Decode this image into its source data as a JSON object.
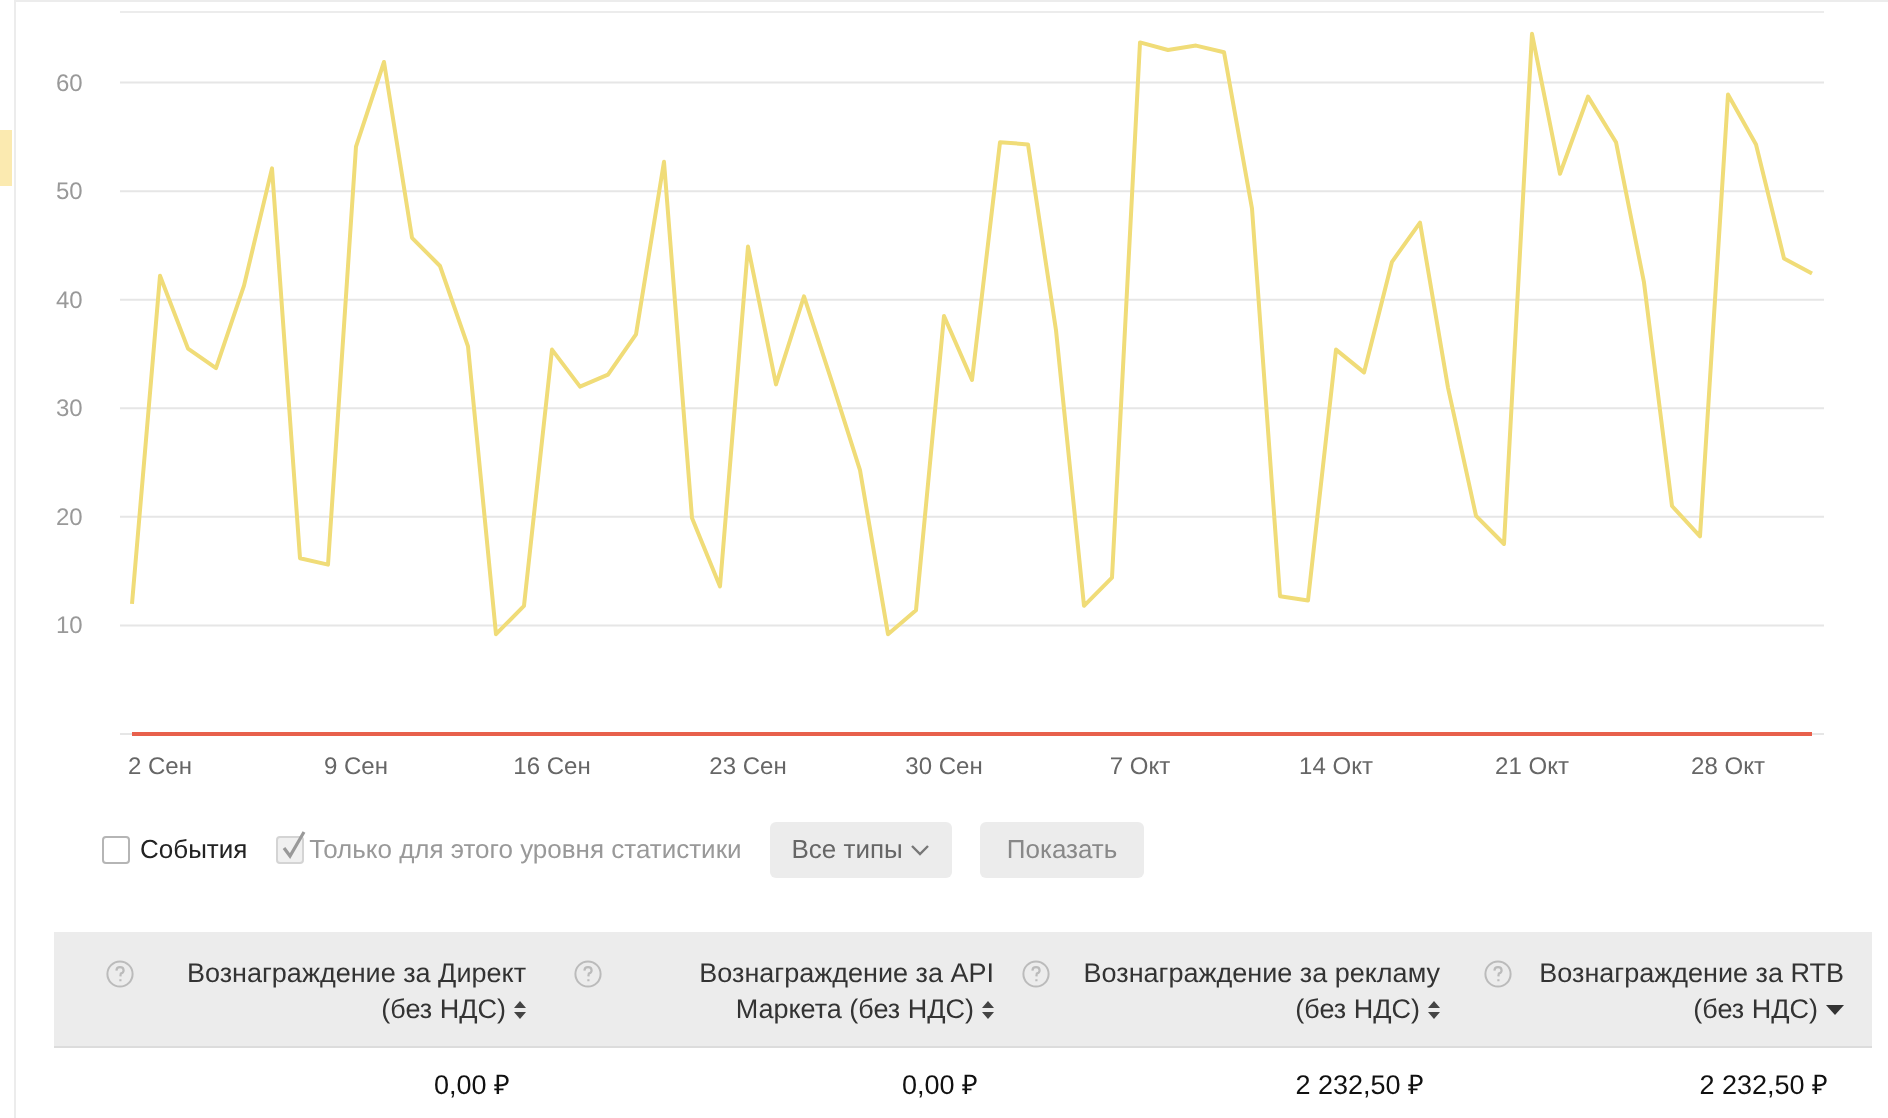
{
  "chart": {
    "chart_data": {
      "type": "line",
      "grid": true,
      "ylim": [
        0,
        66.5
      ],
      "categories": [
        null,
        "2 Сен",
        null,
        null,
        null,
        null,
        null,
        null,
        "9 Сен",
        null,
        null,
        null,
        null,
        null,
        null,
        "16 Сен",
        null,
        null,
        null,
        null,
        null,
        null,
        "23 Сен",
        null,
        null,
        null,
        null,
        null,
        null,
        "30 Сен",
        null,
        null,
        null,
        null,
        null,
        null,
        "7 Окт",
        null,
        null,
        null,
        null,
        null,
        null,
        "14 Окт",
        null,
        null,
        null,
        null,
        null,
        null,
        "21 Окт",
        null,
        null,
        null,
        null,
        null,
        null,
        "28 Окт",
        null,
        null,
        null
      ],
      "series": [
        {
          "color": "#f0dc78",
          "values": [
            12,
            42.2,
            35.5,
            33.7,
            41.3,
            52.1,
            16.2,
            15.6,
            54.1,
            61.9,
            45.7,
            43.1,
            35.7,
            9.2,
            11.8,
            35.4,
            32,
            33.1,
            36.8,
            52.7,
            19.9,
            13.6,
            44.9,
            32.2,
            40.3,
            32.4,
            24.3,
            9.2,
            11.4,
            38.5,
            32.6,
            54.5,
            54.3,
            37.2,
            11.8,
            14.4,
            63.7,
            63,
            63.4,
            62.8,
            48.4,
            12.7,
            12.3,
            35.4,
            33.3,
            43.5,
            47.1,
            31.9,
            20.1,
            17.5,
            64.5,
            51.6,
            58.7,
            54.5,
            41.6,
            21,
            18.2,
            58.9,
            54.3,
            43.8,
            42.4
          ]
        },
        {
          "color": "#e8604c",
          "values": [
            0,
            0,
            0,
            0,
            0,
            0,
            0,
            0,
            0,
            0,
            0,
            0,
            0,
            0,
            0,
            0,
            0,
            0,
            0,
            0,
            0,
            0,
            0,
            0,
            0,
            0,
            0,
            0,
            0,
            0,
            0,
            0,
            0,
            0,
            0,
            0,
            0,
            0,
            0,
            0,
            0,
            0,
            0,
            0,
            0,
            0,
            0,
            0,
            0,
            0,
            0,
            0,
            0,
            0,
            0,
            0,
            0,
            0,
            0,
            0,
            0
          ]
        }
      ],
      "yticks": [
        10,
        20,
        30,
        40,
        50,
        60
      ]
    }
  },
  "filters": {
    "events": {
      "label": "События",
      "checked": false,
      "disabled": false
    },
    "this_level_only": {
      "label": "Только для этого уровня статистики",
      "checked": true,
      "disabled": true
    },
    "types_dropdown": {
      "label": "Все типы"
    },
    "show_button": {
      "label": "Показать"
    }
  },
  "table": {
    "columns": [
      {
        "label": "Вознаграждение за Директ (без НДС)",
        "sorted": false
      },
      {
        "label": "Вознаграждение за API Маркета (без НДС)",
        "sorted": false
      },
      {
        "label": "Вознаграждение за рекламу (без НДС)",
        "sorted": false
      },
      {
        "label": "Вознаграждение за RTB (без НДС)",
        "sorted": true
      }
    ],
    "rows": [
      {
        "cells": [
          "0,00 ₽",
          "0,00 ₽",
          "2 232,50 ₽",
          "2 232,50 ₽"
        ]
      }
    ]
  }
}
